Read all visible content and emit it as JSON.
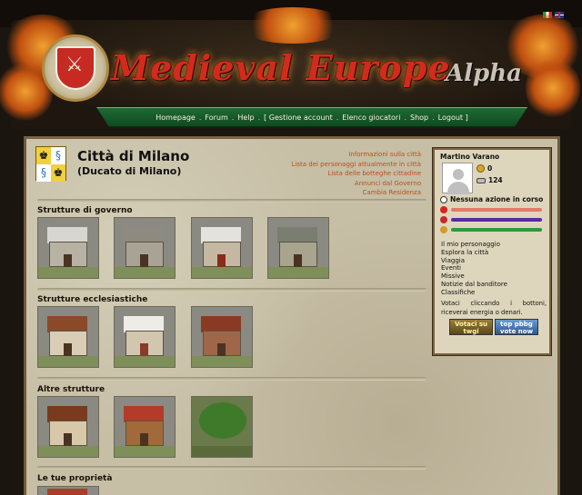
{
  "header": {
    "title": "Medieval Europe",
    "tag": "Alpha",
    "nav": [
      {
        "label": "Homepage"
      },
      {
        "label": "Forum"
      },
      {
        "label": "Help"
      },
      {
        "label": "[ Gestione account"
      },
      {
        "label": "Elenco giocatori"
      },
      {
        "label": "Shop"
      },
      {
        "label": "Logout ]"
      }
    ]
  },
  "city": {
    "name": "Città di Milano",
    "subtitle": "(Ducato di Milano)",
    "links": [
      "Informazioni sulla città",
      "Lista dei personaggi attualmente in città",
      "Lista delle botteghe cittadine",
      "Annunci dal Governo",
      "Cambia Residenza"
    ]
  },
  "sections": [
    {
      "title": "Strutture di governo"
    },
    {
      "title": "Strutture ecclesiastiche"
    },
    {
      "title": "Altre strutture"
    },
    {
      "title": "Le tue proprietà"
    }
  ],
  "panel": {
    "name": "Martino Varano",
    "coins": "0",
    "xp": "124",
    "action": "Nessuna azione in corso",
    "bars": [
      {
        "name": "health",
        "color": "#e24a3a",
        "track": "#f0a080",
        "value": 1.0
      },
      {
        "name": "energy",
        "color": "#6a2aa0",
        "track": "#a06ad0",
        "value": 1.0
      },
      {
        "name": "stamina",
        "color": "#2a9a3a",
        "track": "#7ad07a",
        "value": 1.0
      }
    ],
    "menu": [
      "Il mio personaggio",
      "Esplora la città",
      "Viaggia",
      "Eventi",
      "Missive",
      "Notizie dal banditore",
      "Classifiche"
    ],
    "note": "Votaci cliccando i bottoni, riceverai energia o denari.",
    "vote1": "Votaci su twgi",
    "vote2": "top pbbg vote now"
  },
  "colors": {
    "link": "#b8501a",
    "title_red": "#d42a1c",
    "nav_green": "#1f6a35"
  }
}
